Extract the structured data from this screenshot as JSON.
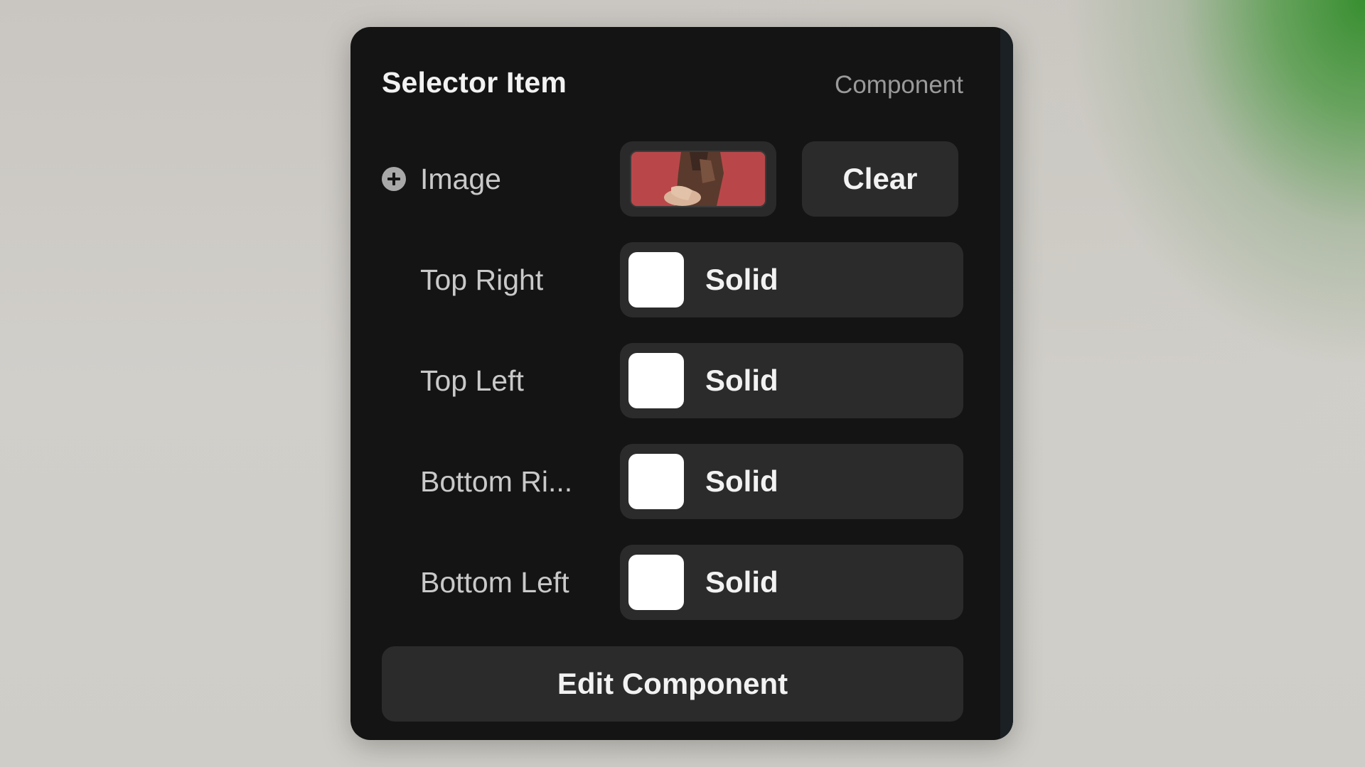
{
  "panel": {
    "title": "Selector Item",
    "subtitle": "Component"
  },
  "image_row": {
    "label": "Image",
    "icon": "plus-circle-icon",
    "clear_label": "Clear"
  },
  "fill_rows": [
    {
      "label": "Top Right",
      "fill_type": "Solid",
      "color": "#FFFFFF"
    },
    {
      "label": "Top Left",
      "fill_type": "Solid",
      "color": "#FFFFFF"
    },
    {
      "label": "Bottom Ri...",
      "fill_type": "Solid",
      "color": "#FFFFFF"
    },
    {
      "label": "Bottom Left",
      "fill_type": "Solid",
      "color": "#FFFFFF"
    }
  ],
  "edit_button_label": "Edit Component",
  "colors": {
    "panel_bg": "#141414",
    "control_bg": "#2B2B2B",
    "text_primary": "#F2F2F2",
    "text_secondary": "#9A9A9A",
    "thumbnail_bg": "#B84A4A"
  }
}
